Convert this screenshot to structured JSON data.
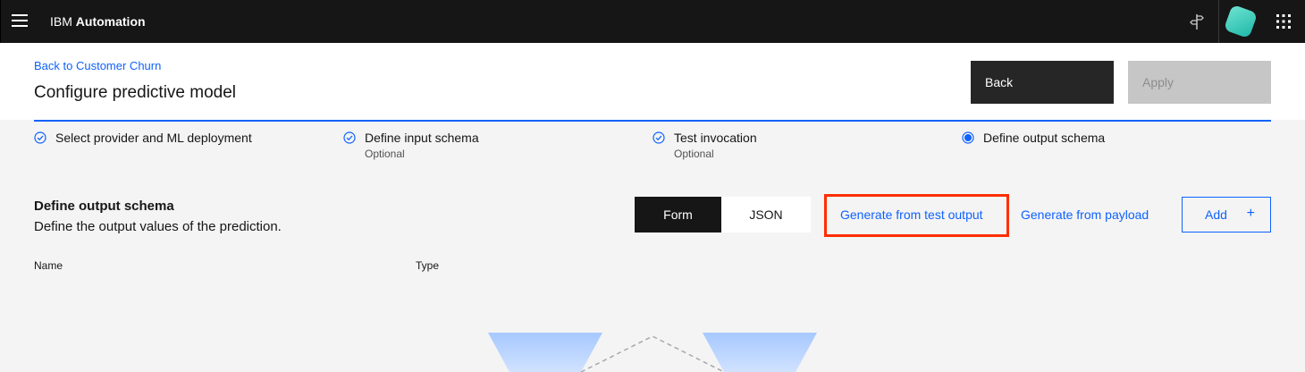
{
  "topnav": {
    "brand_prefix": "IBM",
    "brand_name": "Automation",
    "icons": [
      "menu-icon",
      "signpost-icon",
      "avatar-icon",
      "app-switcher-icon"
    ]
  },
  "header": {
    "back_link": "Back to Customer Churn",
    "title": "Configure predictive model",
    "back_button": "Back",
    "apply_button": "Apply"
  },
  "steps": [
    {
      "label": "Select provider and ML deployment",
      "sub": "",
      "state": "complete"
    },
    {
      "label": "Define input schema",
      "sub": "Optional",
      "state": "complete"
    },
    {
      "label": "Test invocation",
      "sub": "Optional",
      "state": "complete"
    },
    {
      "label": "Define output schema",
      "sub": "",
      "state": "current"
    }
  ],
  "section": {
    "title": "Define output schema",
    "description": "Define the output values of the prediction.",
    "toggle": {
      "form": "Form",
      "json": "JSON",
      "selected": "Form"
    },
    "generate_test": "Generate from test output",
    "generate_payload": "Generate from payload",
    "add_button": "Add",
    "add_icon": "+"
  },
  "table": {
    "columns": [
      "Name",
      "Type"
    ]
  },
  "colors": {
    "accent": "#0f62fe",
    "highlight": "#ff2e00",
    "nav_bg": "#161616"
  }
}
